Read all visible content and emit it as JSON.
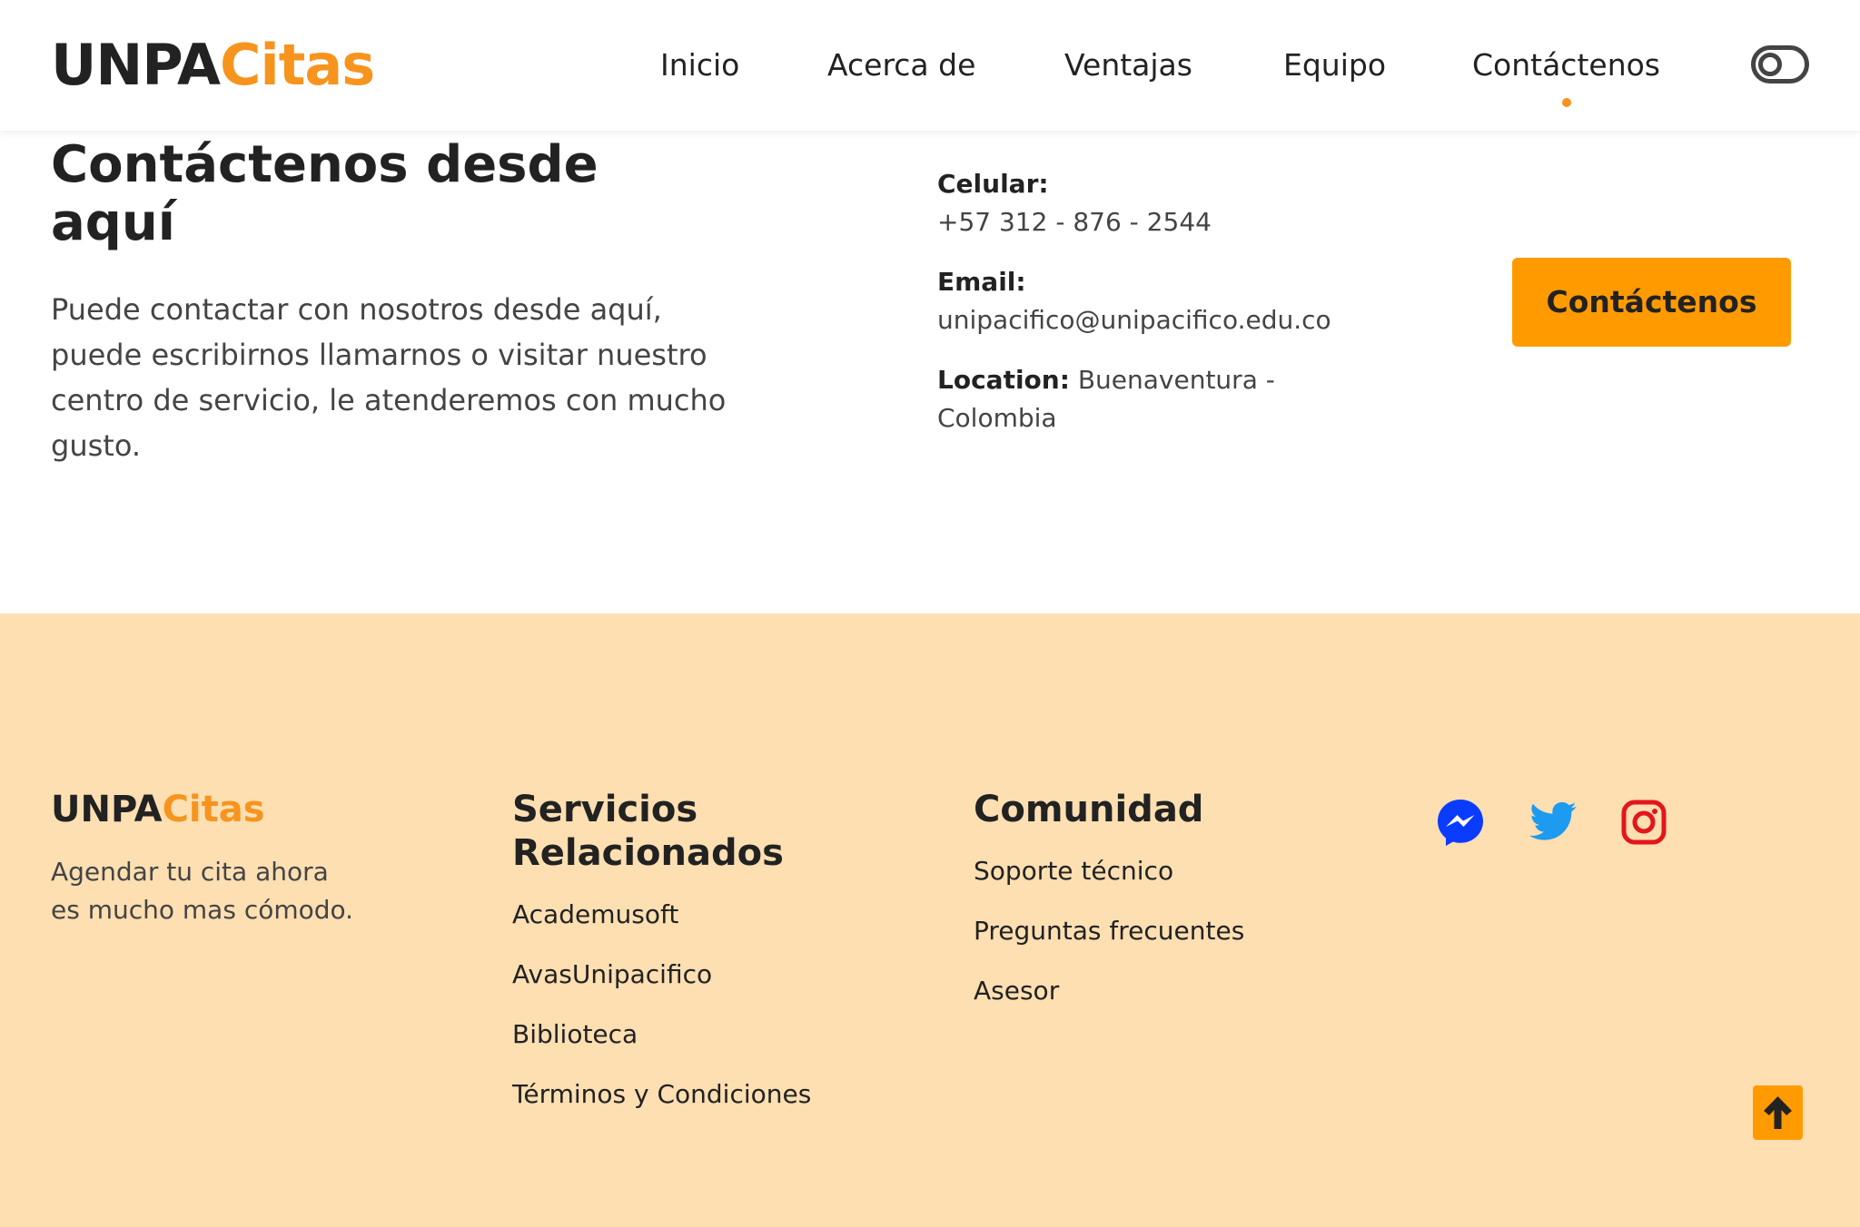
{
  "header": {
    "logo_main": "UNPA",
    "logo_accent": "Citas",
    "nav": [
      "Inicio",
      "Acerca de",
      "Ventajas",
      "Equipo",
      "Contáctenos"
    ],
    "active_nav": "Contáctenos"
  },
  "contact": {
    "title": "Contáctenos desde aquí",
    "description": "Puede contactar con nosotros desde aquí, puede escribirnos llamarnos o visitar nuestro centro de servicio, le atenderemos con mucho gusto.",
    "phone_label": "Celular:",
    "phone_value": "+57 312 - 876 - 2544",
    "email_label": "Email:",
    "email_value": "unipacifico@unipacifico.edu.co",
    "location_label": "Location:",
    "location_value": "Buenaventura - Colombia",
    "cta_label": "Contáctenos"
  },
  "footer": {
    "logo_main": "UNPA",
    "logo_accent": "Citas",
    "tagline": "Agendar tu cita ahora es mucho mas cómodo.",
    "services_title": "Servicios Relacionados",
    "services": [
      "Academusoft",
      "AvasUnipacifico",
      "Biblioteca",
      "Términos y Condiciones"
    ],
    "community_title": "Comunidad",
    "community": [
      "Soporte técnico",
      "Preguntas frecuentes",
      "Asesor"
    ],
    "social": [
      "messenger-icon",
      "twitter-icon",
      "instagram-icon"
    ]
  },
  "colors": {
    "accent": "#f7941d",
    "cta": "#ff9b00",
    "footer_bg": "#fddfb2",
    "messenger": "#0a3cff",
    "twitter": "#1d9bf0",
    "instagram": "#e4161b"
  }
}
